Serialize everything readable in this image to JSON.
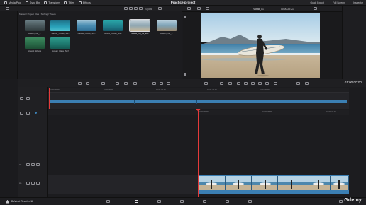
{
  "topbar": {
    "media_pool": "Media Pool",
    "sync_bin": "Sync Bin",
    "transform": "Transform",
    "titles": "Titles",
    "effects": "Effects",
    "project_title": "Practice project",
    "quick_export": "Quick Export",
    "full_screen": "Full Screen",
    "inspector": "Inspector"
  },
  "media_pool": {
    "path": "Master / Project Files / Surfing / Videos",
    "clips": [
      {
        "label": "Hawaii_run_..."
      },
      {
        "label": "Hawaii_Chase_Surf"
      },
      {
        "label": "Hawaii_Chase_Surf"
      },
      {
        "label": "Hawaii_Chase_Surf"
      },
      {
        "label": "Hawaii_run_02_surf"
      },
      {
        "label": "Hawaii_run_..."
      },
      {
        "label": "Hawaii_Waves"
      },
      {
        "label": "Hawaii_Wake_Surf"
      }
    ],
    "sort_label": "Sports"
  },
  "viewer": {
    "clip_name": "Hawaii_01",
    "timecode_top": "00:00:22:21",
    "timecode_main": "01:00:00:00"
  },
  "timeline": {
    "upper_ruler": [
      "01:00:00:00",
      "01:00:30:00",
      "01:01:00:00",
      "01:01:30:00",
      "01:02:00:00"
    ],
    "lower_ruler": [
      "01:00:00:00",
      "01:00:05:00",
      "01:00:10:00"
    ],
    "track_numbers": [
      "V1",
      "A1"
    ]
  },
  "footer": {
    "app_name": "DaVinci Resolve 18",
    "watermark": "Gdemy"
  },
  "colors": {
    "accent_red": "#e53a3a",
    "clip_blue": "#3b7fb3",
    "panel": "#1c1c1f"
  }
}
